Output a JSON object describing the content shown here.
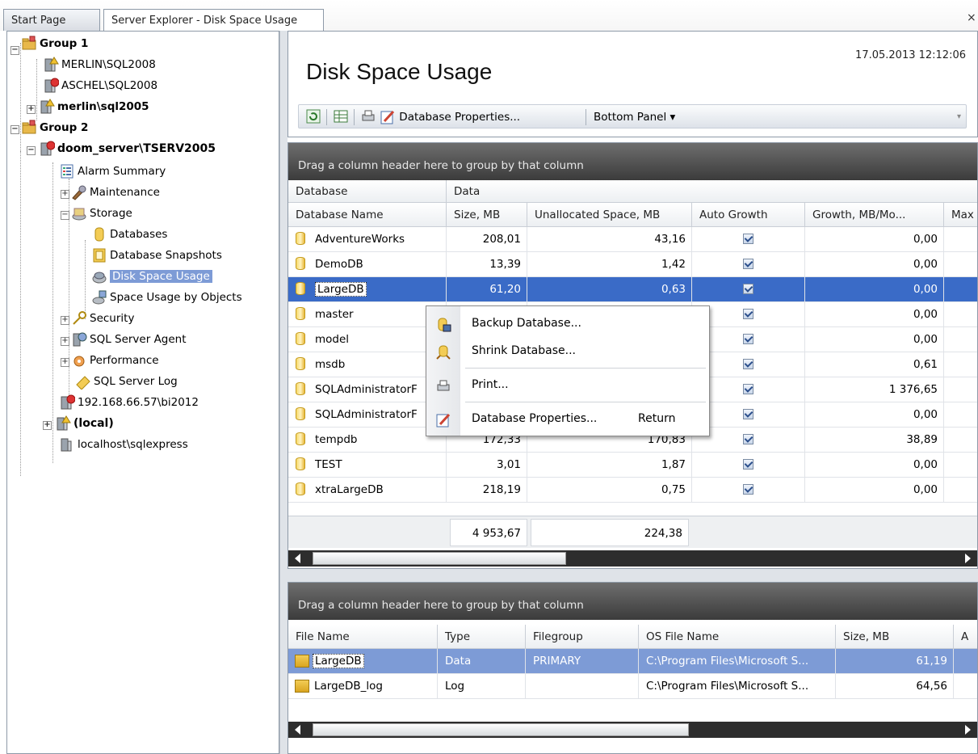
{
  "tabs": [
    {
      "label": "Start Page"
    },
    {
      "label": "Server Explorer - Disk Space Usage"
    }
  ],
  "close_label": "×",
  "tree": [
    {
      "label": "Group 1"
    },
    {
      "label": "MERLIN\\SQL2008"
    },
    {
      "label": "ASCHEL\\SQL2008"
    },
    {
      "label": "merlin\\sql2005"
    },
    {
      "label": "Group 2"
    },
    {
      "label": "doom_server\\TSERV2005"
    },
    {
      "label": "Alarm Summary"
    },
    {
      "label": "Maintenance"
    },
    {
      "label": "Storage"
    },
    {
      "label": "Databases"
    },
    {
      "label": "Database Snapshots"
    },
    {
      "label": "Disk Space Usage"
    },
    {
      "label": "Space Usage by Objects"
    },
    {
      "label": "Security"
    },
    {
      "label": "SQL Server Agent"
    },
    {
      "label": "Performance"
    },
    {
      "label": "SQL Server Log"
    },
    {
      "label": "192.168.66.57\\bi2012"
    },
    {
      "label": "(local)"
    },
    {
      "label": "localhost\\sqlexpress"
    }
  ],
  "header": {
    "title": "Disk Space Usage",
    "datetime": "17.05.2013 12:12:06"
  },
  "toolbar": {
    "db_props": "Database Properties...",
    "bottom_panel": "Bottom Panel ▾"
  },
  "grid": {
    "group_hint": "Drag a column header here to group by that column",
    "bands": [
      "Database",
      "Data"
    ],
    "columns": [
      "Database Name",
      "Size, MB",
      "Unallocated Space, MB",
      "Auto Growth",
      "Growth, MB/Mo...",
      "Max"
    ],
    "rows": [
      {
        "name": "AdventureWorks",
        "size": "208,01",
        "unalloc": "43,16",
        "growth": "0,00"
      },
      {
        "name": "DemoDB",
        "size": "13,39",
        "unalloc": "1,42",
        "growth": "0,00"
      },
      {
        "name": "LargeDB",
        "size": "61,20",
        "unalloc": "0,63",
        "growth": "0,00"
      },
      {
        "name": "master",
        "size": "",
        "unalloc": "",
        "growth": "0,00"
      },
      {
        "name": "model",
        "size": "",
        "unalloc": "",
        "growth": "0,00"
      },
      {
        "name": "msdb",
        "size": "",
        "unalloc": "",
        "growth": "0,61"
      },
      {
        "name": "SQLAdministratorF",
        "size": "",
        "unalloc": "",
        "growth": "1 376,65"
      },
      {
        "name": "SQLAdministratorF",
        "size": "",
        "unalloc": "",
        "growth": "0,00"
      },
      {
        "name": "tempdb",
        "size": "172,33",
        "unalloc": "170,83",
        "growth": "38,89"
      },
      {
        "name": "TEST",
        "size": "3,01",
        "unalloc": "1,87",
        "growth": "0,00"
      },
      {
        "name": "xtraLargeDB",
        "size": "218,19",
        "unalloc": "0,75",
        "growth": "0,00"
      }
    ],
    "totals": {
      "size": "4 953,67",
      "unalloc": "224,38"
    }
  },
  "context_menu": [
    {
      "label": "Backup Database..."
    },
    {
      "label": "Shrink Database..."
    },
    {
      "label": "Print..."
    },
    {
      "label": "Database Properties...",
      "shortcut": "Return"
    }
  ],
  "bottom": {
    "group_hint": "Drag a column header here to group by that column",
    "columns": [
      "File Name",
      "Type",
      "Filegroup",
      "OS File Name",
      "Size, MB",
      "A"
    ],
    "rows": [
      {
        "file": "LargeDB",
        "type": "Data",
        "filegroup": "PRIMARY",
        "os": "C:\\Program Files\\Microsoft S...",
        "size": "61,19"
      },
      {
        "file": "LargeDB_log",
        "type": "Log",
        "filegroup": "",
        "os": "C:\\Program Files\\Microsoft S...",
        "size": "64,56"
      }
    ]
  },
  "colors": {
    "selection": "#3a6bc7",
    "tree_selection": "#7d9bd6",
    "group_band": "#4a4a4a"
  }
}
